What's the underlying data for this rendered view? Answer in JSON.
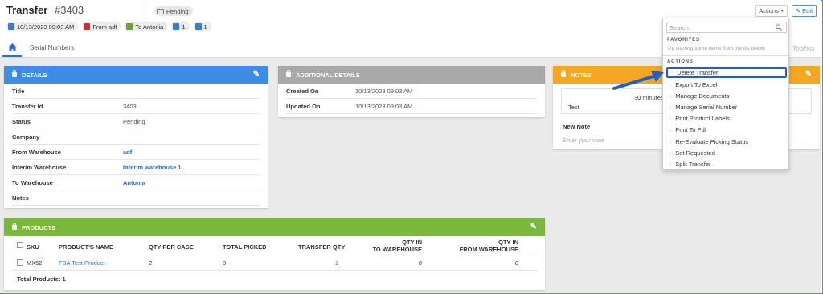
{
  "header": {
    "title": "Transfer",
    "id": "#3403",
    "status": "Pending",
    "chips": [
      {
        "label": "10/13/2023 09:03 AM",
        "icon": "calendar-icon",
        "color": "#3b7bd4"
      },
      {
        "label": "From adf",
        "icon": "warehouse-icon",
        "color": "#c9302c"
      },
      {
        "label": "To Antonia",
        "icon": "warehouse-icon",
        "color": "#6aa336"
      },
      {
        "label": "1",
        "icon": "hierarchy-icon",
        "color": "#3b7bd4"
      },
      {
        "label": "1",
        "icon": "network-icon",
        "color": "#3b7bd4"
      }
    ],
    "actions_label": "Actions",
    "edit_label": "Edit"
  },
  "tabs": {
    "serial_numbers": "Serial Numbers",
    "toolbox": "Toolbox"
  },
  "details": {
    "header": "DETAILS",
    "rows": [
      {
        "label": "Title",
        "value": ""
      },
      {
        "label": "Transfer Id",
        "value": "3403"
      },
      {
        "label": "Status",
        "value": "Pending"
      },
      {
        "label": "Company",
        "value": ""
      },
      {
        "label": "From Warehouse",
        "value": "adf"
      },
      {
        "label": "Interim Warehouse",
        "value": "Interim warehouse 1"
      },
      {
        "label": "To Warehouse",
        "value": "Antonia"
      },
      {
        "label": "Notes",
        "value": ""
      }
    ]
  },
  "additional": {
    "header": "ADDITIONAL DETAILS",
    "rows": [
      {
        "label": "Created On",
        "value": "10/13/2023 09:03 AM"
      },
      {
        "label": "Updated On",
        "value": "10/13/2023 09:03 AM"
      }
    ]
  },
  "notes": {
    "header": "NOTES",
    "note_text": "Test",
    "note_time": "30 minutes",
    "new_note_label": "New Note",
    "new_note_placeholder": "Enter your note"
  },
  "products": {
    "header": "PRODUCTS",
    "columns": [
      "SKU",
      "PRODUCT'S NAME",
      "QTY PER CASE",
      "TOTAL PICKED",
      "TRANSFER QTY",
      "QTY IN",
      "TO WAREHOUSE",
      "QTY IN",
      "FROM WAREHOUSE"
    ],
    "rows": [
      {
        "sku": "MX52",
        "name": "FBA Test Product",
        "qty_per_case": "2",
        "total_picked": "0",
        "transfer_qty": "1",
        "qty_to": "0",
        "qty_from": "0"
      }
    ],
    "total_label": "Total Products: 1"
  },
  "dropdown": {
    "search_placeholder": "Search",
    "favorites_label": "FAVORITES",
    "favorites_hint": "Try starring some items from the list below.",
    "actions_label": "ACTIONS",
    "items": [
      "Delete Transfer",
      "Export To Excel",
      "Manage Documents",
      "Manage Serial Number",
      "Print Product Labels",
      "Print To Pdf",
      "Re-Evaluate Picking Status",
      "Set Requested",
      "Split Transfer"
    ]
  },
  "colors": {
    "details": "#3d8ce6",
    "additional": "#a8a8a8",
    "notes": "#f5a623",
    "products": "#7ab83c",
    "link": "#2a6ed0",
    "annotation_arrow": "#1f5fc9"
  }
}
